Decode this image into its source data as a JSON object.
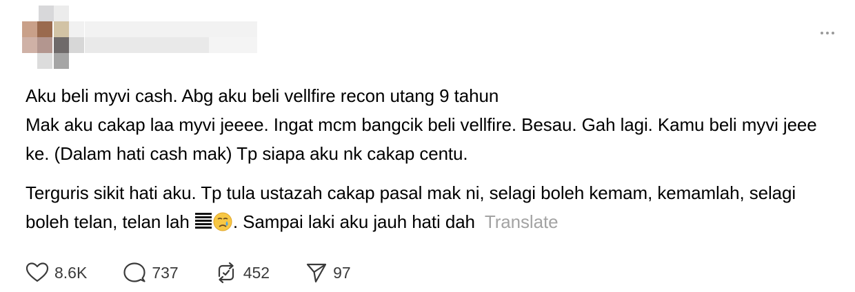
{
  "post": {
    "paragraphs": [
      "Aku beli myvi cash. Abg aku beli vellfire recon utang 9 tahun",
      "Mak aku cakap laa myvi jeeee. Ingat mcm bangcik beli vellfire. Besau. Gah lagi. Kamu beli myvi jeee ke. (Dalam hati cash mak) Tp siapa aku nk cakap centu."
    ],
    "para3_before": "Terguris sikit hati aku. Tp tula ustazah cakap pasal mak ni, selagi boleh kemam, kemamlah, selagi boleh telan, telan lah",
    "para3_after": ". Sampai laki aku jauh hati dah",
    "translate_label": "Translate",
    "emoji": [
      "flag-lines-emoji",
      "crying-face-emoji"
    ]
  },
  "actions": {
    "like_count": "8.6K",
    "reply_count": "737",
    "repost_count": "452",
    "share_count": "97"
  },
  "icons": [
    "more-icon",
    "heart-icon",
    "comment-icon",
    "repost-icon",
    "share-icon"
  ],
  "colors": {
    "text": "#000000",
    "muted": "#a3a3a3",
    "icon": "#3a3a3a"
  }
}
